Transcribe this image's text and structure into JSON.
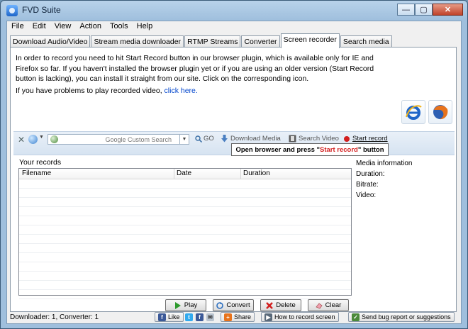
{
  "window": {
    "title": "FVD Suite",
    "minimize": "—",
    "maximize": "▢",
    "close": "✕"
  },
  "menu": [
    "File",
    "Edit",
    "View",
    "Action",
    "Tools",
    "Help"
  ],
  "tabs": [
    "Download Audio/Video",
    "Stream media downloader",
    "RTMP Streams",
    "Converter",
    "Screen recorder",
    "Search media"
  ],
  "info": {
    "paragraph": "In order to record you need to hit Start Record button in our browser plugin, which is available only for IE and Firefox so far. If you haven't installed the browser plugin yet or if you are using an older version (Start Record button is lacking), you can install it straight from our site. Click on the corresponding icon.",
    "problems_prefix": "If you have problems to play recorded video, ",
    "problems_link": "click here."
  },
  "toolbar": {
    "search_placeholder": "Google Custom Search",
    "go": "GO",
    "download_media": "Download Media",
    "search_video": "Search Video",
    "start_record": "Start record"
  },
  "tooltip": {
    "prefix": "Open browser and press \"",
    "highlight": "Start record",
    "suffix": "\" button"
  },
  "records": {
    "label": "Your records",
    "columns": [
      "Filename",
      "Date",
      "Duration"
    ],
    "rows": []
  },
  "media_info": {
    "header": "Media information",
    "duration": "Duration:",
    "bitrate": "Bitrate:",
    "video": "Video:"
  },
  "buttons": {
    "play": "Play",
    "convert": "Convert",
    "delete": "Delete",
    "clear": "Clear"
  },
  "status": {
    "text": "Downloader: 1, Converter: 1",
    "like": "Like",
    "share": "Share",
    "how_to": "How to record screen",
    "bug": "Send bug report or suggestions"
  },
  "colors": {
    "accent": "#0044cc",
    "record_red": "#d21f1f",
    "ie_blue": "#1f66c9",
    "firefox_orange": "#e8731c"
  }
}
